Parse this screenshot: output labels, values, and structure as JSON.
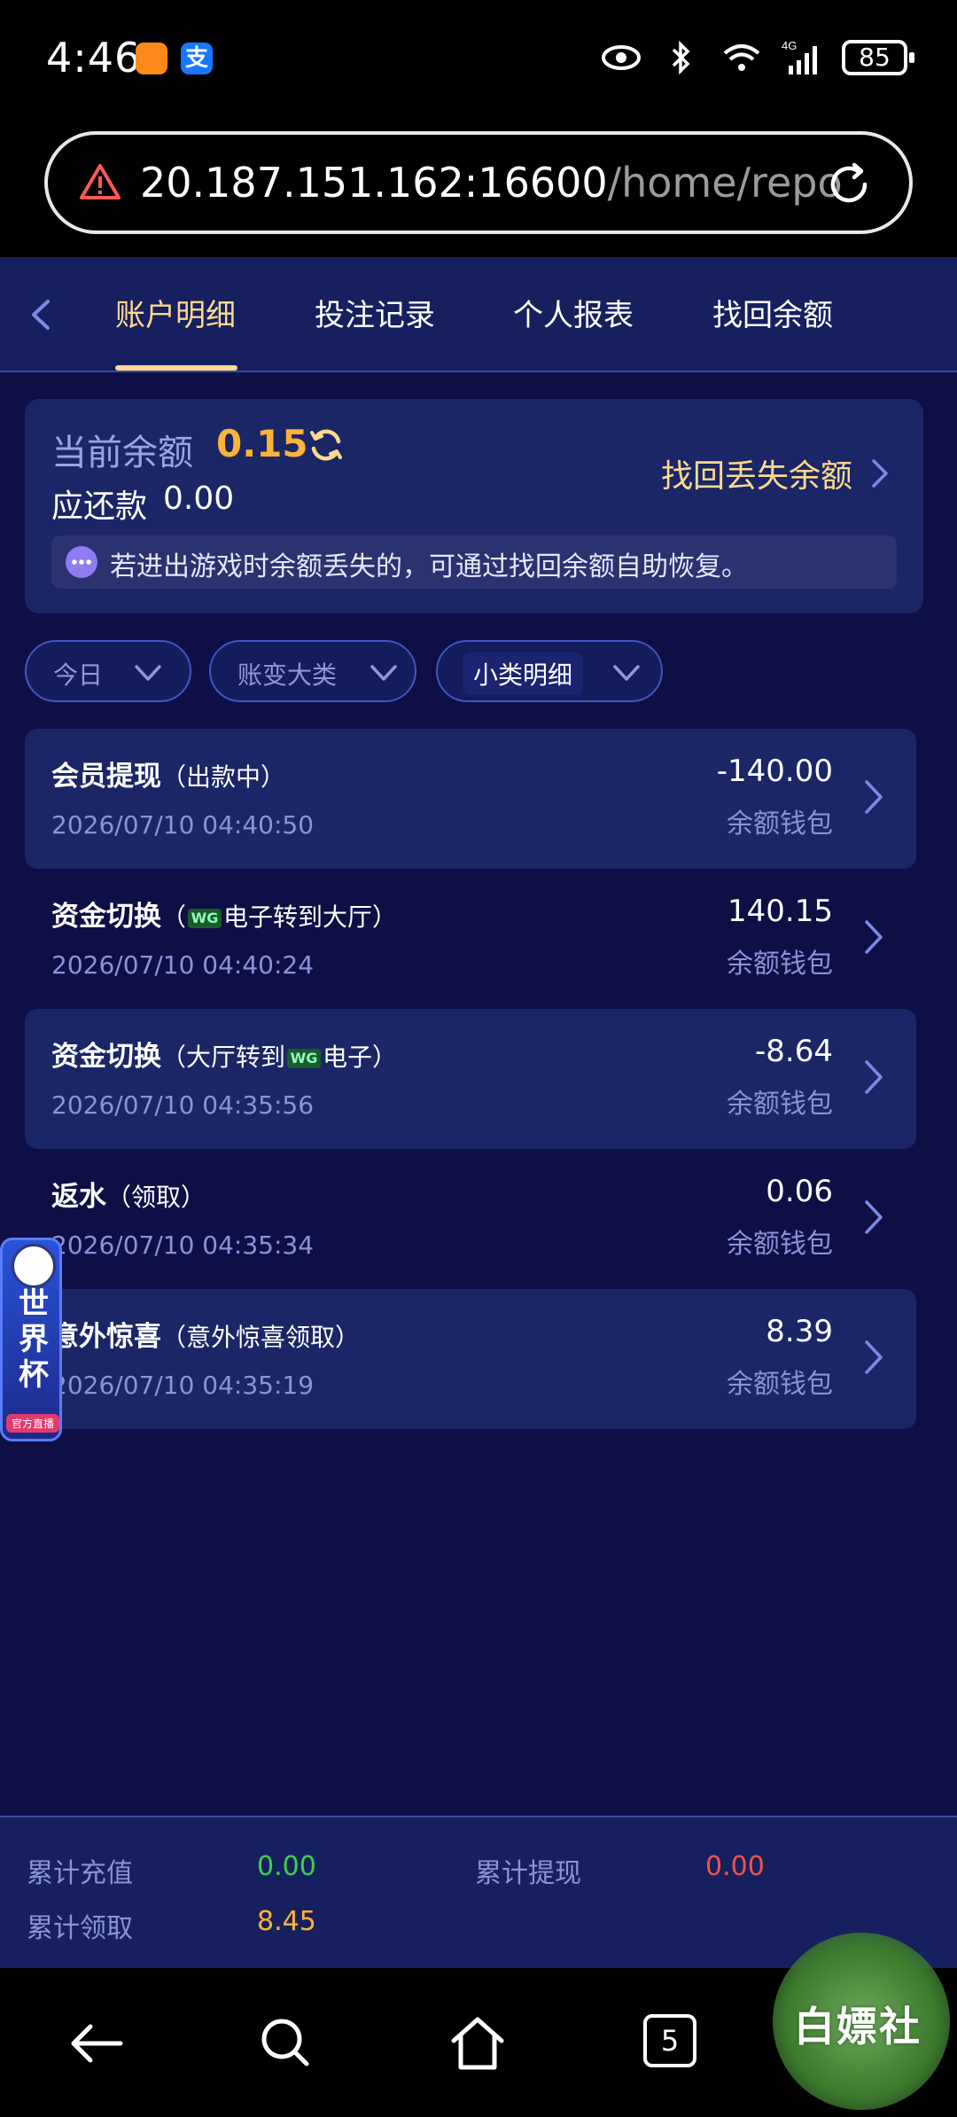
{
  "status_bar": {
    "time": "4:46",
    "battery": "85",
    "network": "4G",
    "alipay_glyph": "支"
  },
  "browser": {
    "url_host": "20.187.151.162:16600",
    "url_path": "/home/repo"
  },
  "tabs": [
    {
      "label": "账户明细",
      "active": true
    },
    {
      "label": "投注记录",
      "active": false
    },
    {
      "label": "个人报表",
      "active": false
    },
    {
      "label": "找回余额",
      "active": false
    }
  ],
  "balance": {
    "label": "当前余额",
    "value": "0.15",
    "owe_label": "应还款",
    "owe_value": "0.00",
    "recover_label": "找回丢失余额",
    "notice": "若进出游戏时余额丢失的，可通过找回余额自助恢复。"
  },
  "filters": [
    {
      "label": "今日"
    },
    {
      "label": "账变大类"
    },
    {
      "label": "小类明细"
    }
  ],
  "transactions": [
    {
      "title": "会员提现",
      "pre": "（出款中）",
      "logo": "",
      "post": "",
      "date": "2026/07/10 04:40:50",
      "amount": "-140.00",
      "wallet": "余额钱包",
      "shaded": true
    },
    {
      "title": "资金切换",
      "pre": "（",
      "logo": "WG",
      "post": "电子转到大厅）",
      "date": "2026/07/10 04:40:24",
      "amount": "140.15",
      "wallet": "余额钱包",
      "shaded": false
    },
    {
      "title": "资金切换",
      "pre": "（大厅转到",
      "logo": "WG",
      "post": "电子）",
      "date": "2026/07/10 04:35:56",
      "amount": "-8.64",
      "wallet": "余额钱包",
      "shaded": true
    },
    {
      "title": "返水",
      "pre": "（领取）",
      "logo": "",
      "post": "",
      "date": "2026/07/10 04:35:34",
      "amount": "0.06",
      "wallet": "余额钱包",
      "shaded": false
    },
    {
      "title": "意外惊喜",
      "pre": "（意外惊喜领取）",
      "logo": "",
      "post": "",
      "date": "2026/07/10 04:35:19",
      "amount": "8.39",
      "wallet": "余额钱包",
      "shaded": true
    }
  ],
  "world_cup_badge": {
    "text": "世界杯",
    "sub": "官方直播"
  },
  "totals": {
    "recharge_label": "累计充值",
    "recharge_value": "0.00",
    "withdraw_label": "累计提现",
    "withdraw_value": "0.00",
    "claim_label": "累计领取",
    "claim_value": "8.45"
  },
  "colors": {
    "positive": "#3fcf4b",
    "negative": "#f0524d",
    "accent": "#ffb238",
    "gold": "#ffd98e"
  },
  "navbar": {
    "tab_count": "5"
  },
  "watermark": {
    "text": "白嫖社"
  }
}
